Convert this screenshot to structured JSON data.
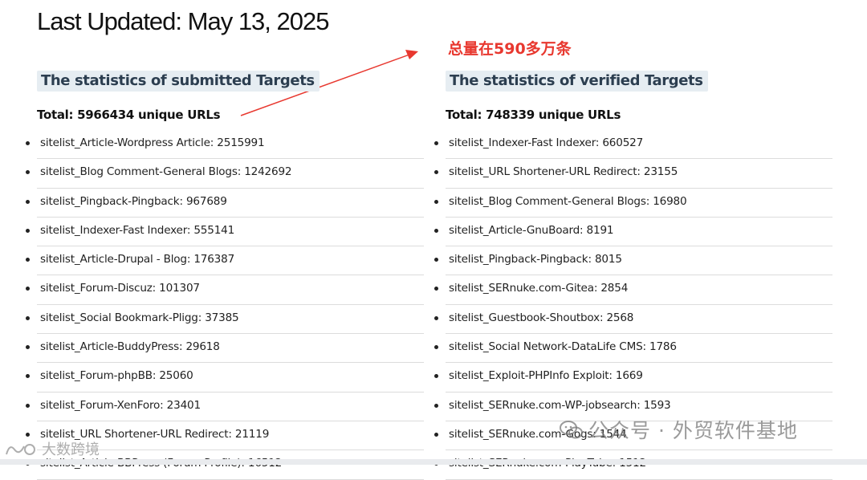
{
  "page": {
    "title": "Last Updated: May 13, 2025"
  },
  "annotation": {
    "text": "总量在590多万条",
    "color": "#e8382f"
  },
  "submitted": {
    "heading": "The statistics of submitted Targets",
    "total": "Total: 5966434 unique URLs",
    "items": [
      "sitelist_Article-Wordpress Article: 2515991",
      "sitelist_Blog Comment-General Blogs: 1242692",
      "sitelist_Pingback-Pingback: 967689",
      "sitelist_Indexer-Fast Indexer: 555141",
      "sitelist_Article-Drupal - Blog: 176387",
      "sitelist_Forum-Discuz: 101307",
      "sitelist_Social Bookmark-Pligg: 37385",
      "sitelist_Article-BuddyPress: 29618",
      "sitelist_Forum-phpBB: 25060",
      "sitelist_Forum-XenForo: 23401",
      "sitelist_URL Shortener-URL Redirect: 21119",
      "sitelist_Article-BBPress (Forum Profile): 16512"
    ]
  },
  "verified": {
    "heading": "The statistics of verified Targets",
    "total": "Total: 748339 unique URLs",
    "items": [
      "sitelist_Indexer-Fast Indexer: 660527",
      "sitelist_URL Shortener-URL Redirect: 23155",
      "sitelist_Blog Comment-General Blogs: 16980",
      "sitelist_Article-GnuBoard: 8191",
      "sitelist_Pingback-Pingback: 8015",
      "sitelist_SERnuke.com-Gitea: 2854",
      "sitelist_Guestbook-Shoutbox: 2568",
      "sitelist_Social Network-DataLife CMS: 1786",
      "sitelist_Exploit-PHPInfo Exploit: 1669",
      "sitelist_SERnuke.com-WP-jobsearch: 1593",
      "sitelist_SERnuke.com-Gogs: 1544",
      "sitelist_SERnuke.com-PlayTube: 1512"
    ]
  },
  "watermarks": {
    "right": "公众号 · 外贸软件基地",
    "left": "大数跨境"
  }
}
